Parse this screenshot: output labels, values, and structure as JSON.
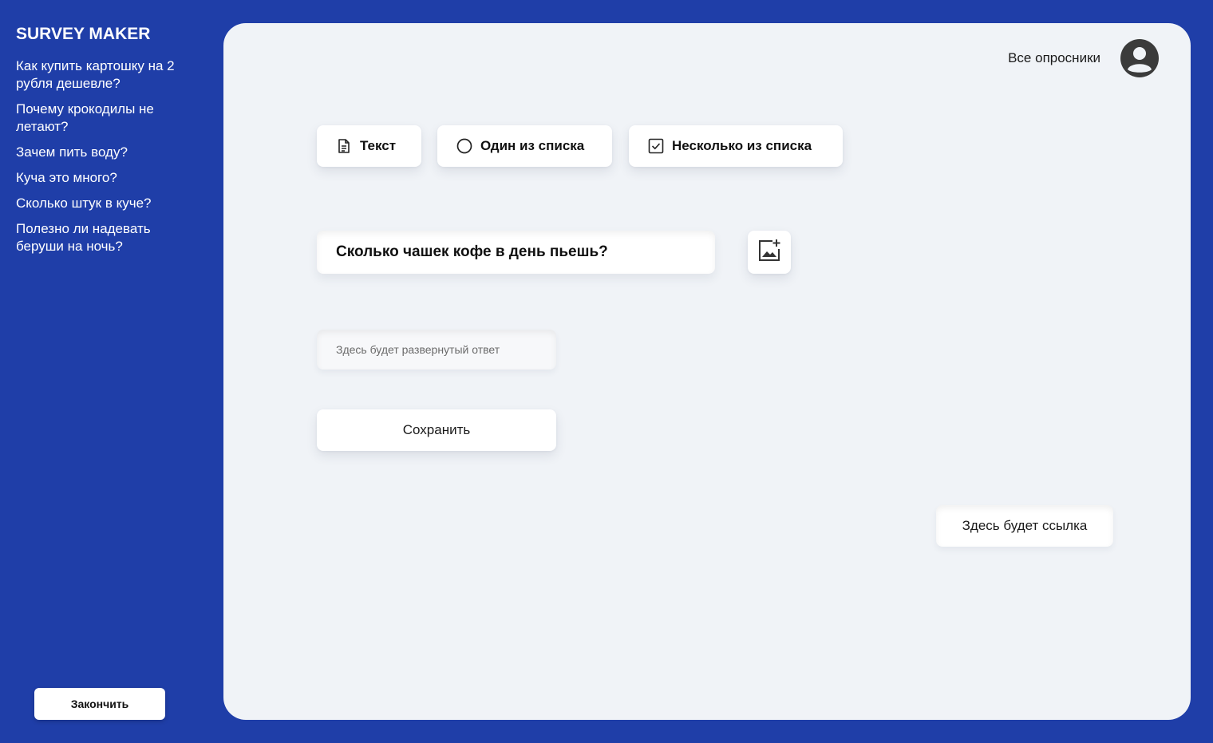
{
  "app": {
    "title": "SURVEY MAKER"
  },
  "sidebar": {
    "surveys": [
      {
        "label": "Как купить картошку на 2 рубля дешевле?"
      },
      {
        "label": "Почему крокодилы не летают?"
      },
      {
        "label": "Зачем пить воду?"
      },
      {
        "label": "Куча это много?"
      },
      {
        "label": "Сколько штук в куче?"
      },
      {
        "label": "Полезно ли надевать беруши на ночь?"
      }
    ],
    "finish_label": "Закончить"
  },
  "header": {
    "all_surveys_label": "Все опросники",
    "avatar_icon": "user-circle-icon"
  },
  "question_types": [
    {
      "label": "Текст",
      "icon": "document-icon"
    },
    {
      "label": "Один из списка",
      "icon": "radio-icon"
    },
    {
      "label": "Несколько из списка",
      "icon": "checkbox-icon"
    }
  ],
  "editor": {
    "question_text": "Сколько чашек кофе в день пьешь?",
    "add_image_icon": "add-image-icon",
    "answer_placeholder": "Здесь будет развернутый ответ",
    "save_label": "Сохранить",
    "link_placeholder": "Здесь будет ссылка"
  },
  "colors": {
    "background": "#1f3ea8",
    "panel": "#f0f3f7",
    "card": "#ffffff"
  }
}
